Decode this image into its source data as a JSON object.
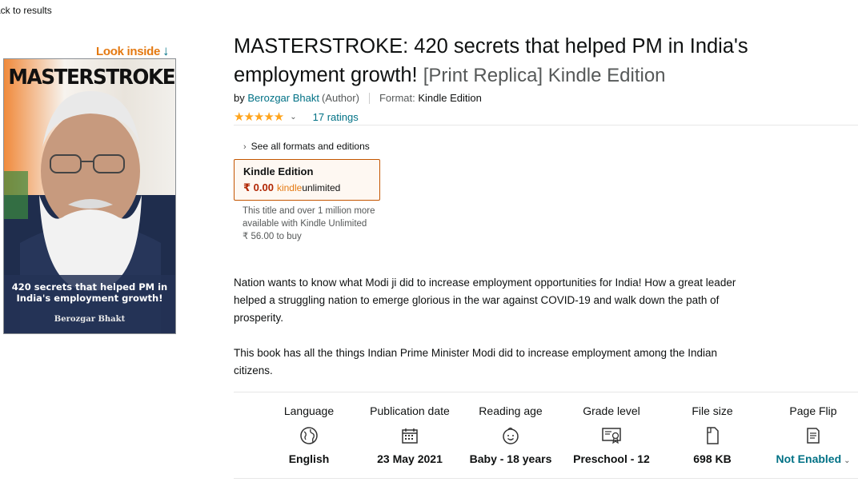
{
  "nav": {
    "back_label": "ack to results"
  },
  "look_inside": {
    "label": "Look inside",
    "arrow": "↓"
  },
  "cover": {
    "title": "MASTERSTROKE",
    "subtitle": "420 secrets that helped PM in India's employment growth!",
    "author": "Berozgar Bhakt"
  },
  "product": {
    "title": "MASTERSTROKE: 420 secrets that helped PM in India's employment growth!",
    "edition": "[Print Replica] Kindle Edition",
    "by_prefix": "by",
    "author": "Berozgar Bhakt",
    "author_role": "(Author)",
    "format_label": "Format:",
    "format_value": "Kindle Edition"
  },
  "rating": {
    "stars": "★★★★★",
    "stars_value": 5,
    "ratings_text": "17 ratings"
  },
  "formats": {
    "link_label": "See all formats and editions"
  },
  "kindle_option": {
    "label": "Kindle Edition",
    "price": "₹ 0.00",
    "ku_brand_1": "kindle",
    "ku_brand_2": "unlimited"
  },
  "ku_note": {
    "line": "This title and over 1 million more available with Kindle Unlimited",
    "buy_price": "₹ 56.00 to buy"
  },
  "description": {
    "p1": "Nation wants to know what Modi ji did to increase employment opportunities for India! How a great leader helped a struggling nation to emerge glorious in the war against COVID-19 and walk down the path of prosperity.",
    "p2": "This book has all the things Indian Prime Minister Modi did to increase employment among the Indian citizens."
  },
  "details": [
    {
      "label": "Language",
      "icon": "globe-icon",
      "value": "English"
    },
    {
      "label": "Publication date",
      "icon": "calendar-icon",
      "value": "23 May 2021"
    },
    {
      "label": "Reading age",
      "icon": "child-face-icon",
      "value": "Baby - 18 years"
    },
    {
      "label": "Grade level",
      "icon": "certificate-icon",
      "value": "Preschool - 12"
    },
    {
      "label": "File size",
      "icon": "file-icon",
      "value": "698 KB"
    },
    {
      "label": "Page Flip",
      "icon": "page-flip-icon",
      "value": "Not Enabled"
    }
  ],
  "colors": {
    "link": "#007185",
    "price": "#B12704",
    "star": "#FFA41C",
    "look_inside": "#E47911",
    "selected_border": "#C45500"
  }
}
